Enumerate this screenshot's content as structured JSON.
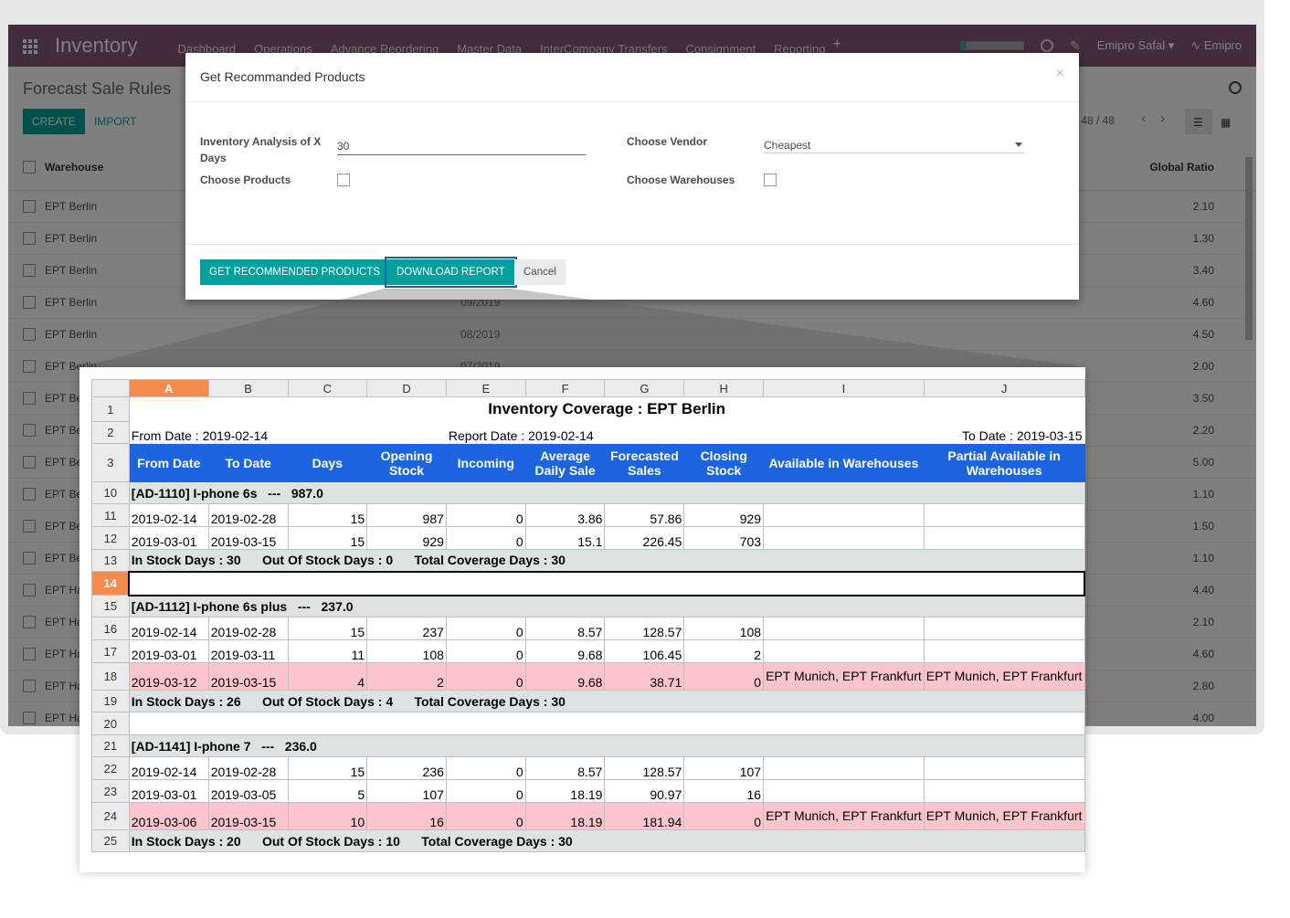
{
  "navbar": {
    "brand": "Inventory",
    "menu": [
      "Dashboard",
      "Operations",
      "Advance Reordering",
      "Master Data",
      "InterCompany Transfers",
      "Consignment",
      "Reporting"
    ],
    "plus": "+",
    "user": "Emipro Safal ▾",
    "company": "Emipro",
    "progress": 0.08
  },
  "control": {
    "breadcrumb": "Forecast Sale Rules",
    "create_label": "CREATE",
    "import_label": "IMPORT",
    "pager": "48 / 48"
  },
  "list": {
    "col_warehouse": "Warehouse",
    "col_ratio": "Global Ratio",
    "rows": [
      {
        "warehouse": "EPT Berlin",
        "period": "",
        "ratio": "2.10"
      },
      {
        "warehouse": "EPT Berlin",
        "period": "",
        "ratio": "1.30"
      },
      {
        "warehouse": "EPT Berlin",
        "period": "",
        "ratio": "3.40"
      },
      {
        "warehouse": "EPT Berlin",
        "period": "09/2019",
        "ratio": "4.60"
      },
      {
        "warehouse": "EPT Berlin",
        "period": "08/2019",
        "ratio": "4.50"
      },
      {
        "warehouse": "EPT Berlin",
        "period": "07/2019",
        "ratio": "2.00"
      },
      {
        "warehouse": "EPT Be",
        "period": "",
        "ratio": "3.50"
      },
      {
        "warehouse": "EPT Be",
        "period": "",
        "ratio": "2.20"
      },
      {
        "warehouse": "EPT Be",
        "period": "",
        "ratio": "5.00"
      },
      {
        "warehouse": "EPT Be",
        "period": "",
        "ratio": "1.10"
      },
      {
        "warehouse": "EPT Be",
        "period": "",
        "ratio": "1.50"
      },
      {
        "warehouse": "EPT Be",
        "period": "",
        "ratio": "1.10"
      },
      {
        "warehouse": "EPT Ha",
        "period": "",
        "ratio": "4.40"
      },
      {
        "warehouse": "EPT Ha",
        "period": "",
        "ratio": "2.10"
      },
      {
        "warehouse": "EPT Ha",
        "period": "",
        "ratio": "4.60"
      },
      {
        "warehouse": "EPT Ha",
        "period": "",
        "ratio": "2.80"
      },
      {
        "warehouse": "EPT Ha",
        "period": "",
        "ratio": "4.00"
      }
    ]
  },
  "modal": {
    "title": "Get Recommanded Products",
    "close": "×",
    "label_days": "Inventory Analysis of X Days",
    "days_value": "30",
    "label_products": "Choose Products",
    "label_vendor": "Choose Vendor",
    "vendor_value": "Cheapest",
    "label_warehouses": "Choose Warehouses",
    "btn_get": "GET RECOMMENDED PRODUCTS",
    "btn_download": "DOWNLOAD REPORT",
    "btn_cancel": "Cancel"
  },
  "sheet": {
    "columns": [
      "A",
      "B",
      "C",
      "D",
      "E",
      "F",
      "G",
      "H",
      "I",
      "J"
    ],
    "title": "Inventory Coverage : EPT Berlin",
    "from_date": "From Date : 2019-02-14",
    "report_date": "Report Date : 2019-02-14",
    "to_date": "To Date : 2019-03-15",
    "headers": [
      "From Date",
      "To Date",
      "Days",
      "Opening Stock",
      "Incoming",
      "Average Daily Sale",
      "Forecasted Sales",
      "Closing Stock",
      "Available in Warehouses",
      "Partial Available in Warehouses"
    ],
    "rows": [
      {
        "n": "10",
        "kind": "product",
        "text": "[AD-1110] I-phone 6s   ---   987.0"
      },
      {
        "n": "11",
        "kind": "data",
        "cells": [
          "2019-02-14",
          "2019-02-28",
          "15",
          "987",
          "0",
          "3.86",
          "57.86",
          "929",
          "",
          ""
        ]
      },
      {
        "n": "12",
        "kind": "data",
        "cells": [
          "2019-03-01",
          "2019-03-15",
          "15",
          "929",
          "0",
          "15.1",
          "226.45",
          "703",
          "",
          ""
        ]
      },
      {
        "n": "13",
        "kind": "summary",
        "text": "In Stock Days : 30      Out Of Stock Days : 0      Total Coverage Days : 30"
      },
      {
        "n": "14",
        "kind": "blank",
        "selected": true
      },
      {
        "n": "15",
        "kind": "product",
        "text": "[AD-1112] I-phone 6s plus   ---   237.0"
      },
      {
        "n": "16",
        "kind": "data",
        "cells": [
          "2019-02-14",
          "2019-02-28",
          "15",
          "237",
          "0",
          "8.57",
          "128.57",
          "108",
          "",
          ""
        ]
      },
      {
        "n": "17",
        "kind": "data",
        "cells": [
          "2019-03-01",
          "2019-03-11",
          "11",
          "108",
          "0",
          "9.68",
          "106.45",
          "2",
          "",
          ""
        ]
      },
      {
        "n": "18",
        "kind": "data",
        "pink": true,
        "cells": [
          "2019-03-12",
          "2019-03-15",
          "4",
          "2",
          "0",
          "9.68",
          "38.71",
          "0",
          "EPT Munich, EPT Frankfurt",
          "EPT Munich, EPT Frankfurt"
        ]
      },
      {
        "n": "19",
        "kind": "summary",
        "text": "In Stock Days : 26      Out Of Stock Days : 4      Total Coverage Days : 30"
      },
      {
        "n": "20",
        "kind": "blank"
      },
      {
        "n": "21",
        "kind": "product",
        "text": "[AD-1141] I-phone 7   ---   236.0"
      },
      {
        "n": "22",
        "kind": "data",
        "cells": [
          "2019-02-14",
          "2019-02-28",
          "15",
          "236",
          "0",
          "8.57",
          "128.57",
          "107",
          "",
          ""
        ]
      },
      {
        "n": "23",
        "kind": "data",
        "cells": [
          "2019-03-01",
          "2019-03-05",
          "5",
          "107",
          "0",
          "18.19",
          "90.97",
          "16",
          "",
          ""
        ]
      },
      {
        "n": "24",
        "kind": "data",
        "pink": true,
        "cells": [
          "2019-03-06",
          "2019-03-15",
          "10",
          "16",
          "0",
          "18.19",
          "181.94",
          "0",
          "EPT Munich, EPT Frankfurt",
          "EPT Munich, EPT Frankfurt"
        ]
      },
      {
        "n": "25",
        "kind": "summary",
        "text": "In Stock Days : 20      Out Of Stock Days : 10      Total Coverage Days : 30"
      }
    ]
  }
}
